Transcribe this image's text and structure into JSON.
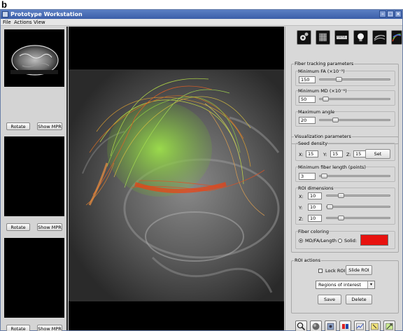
{
  "figure_label": "b",
  "window": {
    "title": "Prototype Workstation",
    "controls": [
      "minimize",
      "maximize",
      "close"
    ]
  },
  "menu": [
    "File",
    "Actions",
    "View"
  ],
  "left_column": {
    "thumbnails": [
      {
        "rotate_label": "Rotate",
        "mpr_label": "Show MPR",
        "has_image": true
      },
      {
        "rotate_label": "Rotate",
        "mpr_label": "Show MPR",
        "has_image": false
      },
      {
        "rotate_label": "Rotate",
        "mpr_label": "Show MPR",
        "has_image": false
      }
    ]
  },
  "toolbar_icons": [
    "gear-icon",
    "cube-icon",
    "ruler-icon",
    "lightbulb-icon",
    "fiber-icon",
    "tractography-icon"
  ],
  "fiber_tracking": {
    "title": "Fiber tracking parameters",
    "min_fa": {
      "label": "Minimum FA (×10⁻³)",
      "value": "150",
      "slider": 0.25
    },
    "min_md": {
      "label": "Minimum MD (×10⁻⁶)",
      "value": "50",
      "slider": 0.04
    },
    "max_angle": {
      "label": "Maximum angle",
      "value": "20",
      "slider": 0.2
    }
  },
  "visualization": {
    "title": "Visualization parameters",
    "seed_density": {
      "label": "Seed density",
      "x_label": "X:",
      "x": "15",
      "y_label": "Y:",
      "y": "15",
      "z_label": "Z:",
      "z": "15",
      "set_label": "Set"
    },
    "min_fiber_length": {
      "label": "Minimum fiber length (points)",
      "value": "3",
      "slider": 0.02
    },
    "roi_dimensions": {
      "label": "ROI dimensions",
      "x_label": "X:",
      "x": "10",
      "x_slider": 0.2,
      "y_label": "Y:",
      "y": "10",
      "y_slider": 0.0,
      "z_label": "Z:",
      "z": "10",
      "z_slider": 0.2
    },
    "fiber_coloring": {
      "label": "Fiber coloring",
      "option1": "MD/FA/Length",
      "option2": "Solid:",
      "selected": "MD/FA/Length",
      "solid_color": "#e8120f"
    }
  },
  "roi_actions": {
    "title": "ROI actions",
    "lock_label": "Lock ROI",
    "lock_checked": false,
    "slide_label": "Slide ROI",
    "dropdown_value": "Regions of interest",
    "save_label": "Save",
    "delete_label": "Delete"
  },
  "bottom_icons": [
    "magnifier-icon",
    "sphere-icon",
    "cube-view-icon",
    "layout-icon",
    "graph-icon",
    "select-icon",
    "transform-icon"
  ],
  "colors": {
    "titlebar": "#3b5ea8",
    "panel": "#d8d8d8",
    "solid_swatch": "#e8120f"
  }
}
